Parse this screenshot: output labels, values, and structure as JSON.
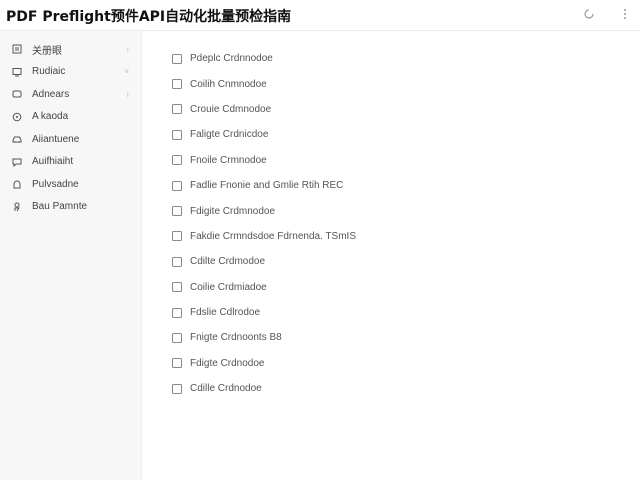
{
  "window": {
    "title": "PDF Preflight预件API自动化批量预检指南"
  },
  "toolbar": {
    "refresh_icon": "refresh-icon",
    "menu_icon": "more-icon"
  },
  "sidebar": {
    "items": [
      {
        "label": "关册眼",
        "icon": "document-icon",
        "chevron": "›"
      },
      {
        "label": "Rudiaic",
        "icon": "monitor-icon",
        "chevron": "˅"
      },
      {
        "label": "Adnears",
        "icon": "window-icon",
        "chevron": "ı"
      },
      {
        "label": "A kaoda",
        "icon": "compass-icon",
        "chevron": ""
      },
      {
        "label": "Aiiantuene",
        "icon": "car-icon",
        "chevron": ""
      },
      {
        "label": "Auifhiaiht",
        "icon": "chat-icon",
        "chevron": ""
      },
      {
        "label": "Pulvsadne",
        "icon": "lock-icon",
        "chevron": ""
      },
      {
        "label": "Bau Pamnte",
        "icon": "person-icon",
        "chevron": ""
      }
    ]
  },
  "main": {
    "rows": [
      {
        "label": "Pdeplc Crdnnodoe"
      },
      {
        "label": "Coilih Cnmnodoe"
      },
      {
        "label": "Crouie Cdmnodoe"
      },
      {
        "label": "Faligte Crdnicdoe"
      },
      {
        "label": "Fnoile Crmnodoe"
      },
      {
        "label": "Fadlie Fnonie and Gmlie Rtih REC"
      },
      {
        "label": "Fdigite Crdmnodoe"
      },
      {
        "label": "Fakdie Crmndsdoe Fdrnenda. TSmIS"
      },
      {
        "label": "Cdilte Crdmodoe"
      },
      {
        "label": "Coilie Crdmiadoe"
      },
      {
        "label": "Fdslie Cdlrodoe"
      },
      {
        "label": "Fnigte Crdnoonts B8"
      },
      {
        "label": "Fdigte Crdnodoe"
      },
      {
        "label": "Cdille Crdnodoe"
      }
    ]
  }
}
